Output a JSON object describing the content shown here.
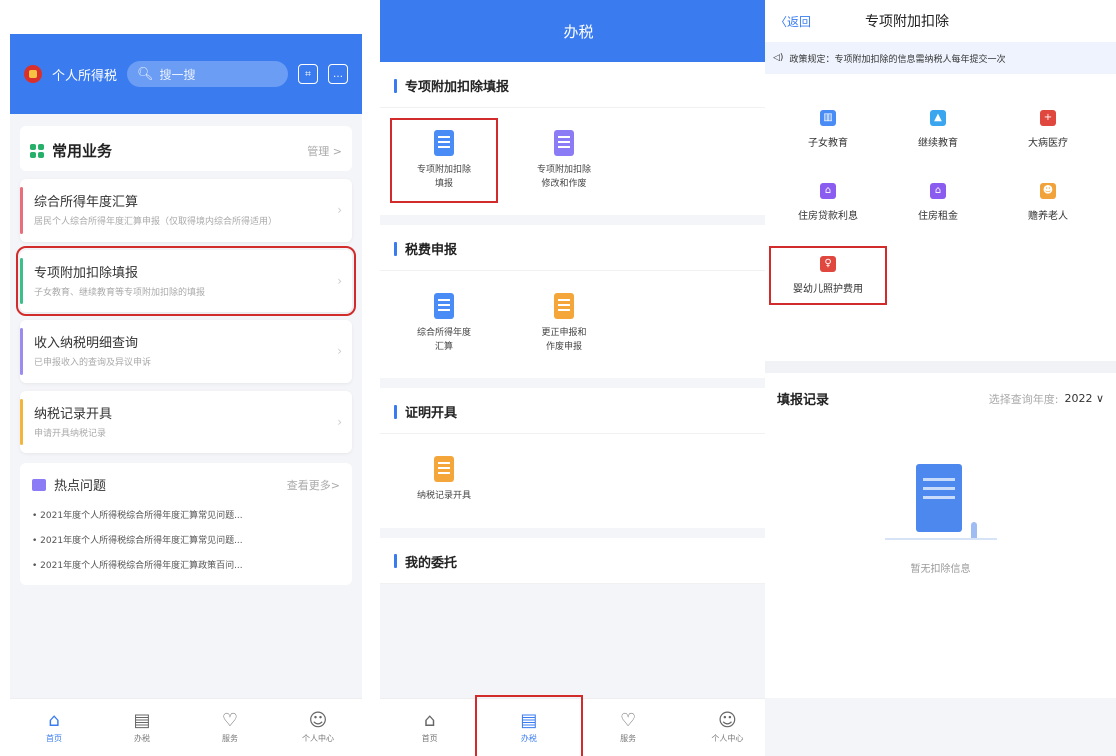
{
  "screen1": {
    "app_title": "个人所得税",
    "search_placeholder": "搜一搜",
    "scan_icon": "scan-icon",
    "message_icon": "message-icon",
    "common": {
      "title": "常用业务",
      "manage": "管理 >",
      "items": [
        {
          "title": "综合所得年度汇算",
          "desc": "居民个人综合所得年度汇算申报（仅取得境内综合所得适用）"
        },
        {
          "title": "专项附加扣除填报",
          "desc": "子女教育、继续教育等专项附加扣除的填报"
        },
        {
          "title": "收入纳税明细查询",
          "desc": "已申报收入的查询及异议申诉"
        },
        {
          "title": "纳税记录开具",
          "desc": "申请开具纳税记录"
        }
      ]
    },
    "hot": {
      "title": "热点问题",
      "more": "查看更多>",
      "items": [
        "• 2021年度个人所得税综合所得年度汇算常见问题...",
        "• 2021年度个人所得税综合所得年度汇算常见问题...",
        "• 2021年度个人所得税综合所得年度汇算政策百问..."
      ]
    },
    "tabs": [
      "首页",
      "办税",
      "服务",
      "个人中心"
    ]
  },
  "screen2": {
    "header_title": "办税",
    "sections": [
      {
        "title": "专项附加扣除填报",
        "tiles": [
          "专项附加扣除\n填报",
          "专项附加扣除\n修改和作废"
        ]
      },
      {
        "title": "税费申报",
        "tiles": [
          "综合所得年度\n汇算",
          "更正申报和\n作废申报"
        ]
      },
      {
        "title": "证明开具",
        "tiles": [
          "纳税记录开具"
        ]
      },
      {
        "title": "我的委托",
        "tiles": []
      }
    ],
    "tabs": [
      "首页",
      "办税",
      "服务",
      "个人中心"
    ]
  },
  "screen3": {
    "back": "〈返回",
    "title": "专项附加扣除",
    "notice": "政策规定：专项附加扣除的信息需纳税人每年提交一次",
    "items": [
      "子女教育",
      "继续教育",
      "大病医疗",
      "住房贷款利息",
      "住房租金",
      "赡养老人",
      "婴幼儿照护费用"
    ],
    "record_title": "填报记录",
    "year_label": "选择查询年度:",
    "year_value": "2022 ∨",
    "empty_text": "暂无扣除信息"
  },
  "colors": {
    "primary": "#3a7cf0",
    "highlight": "#d22b2b"
  }
}
